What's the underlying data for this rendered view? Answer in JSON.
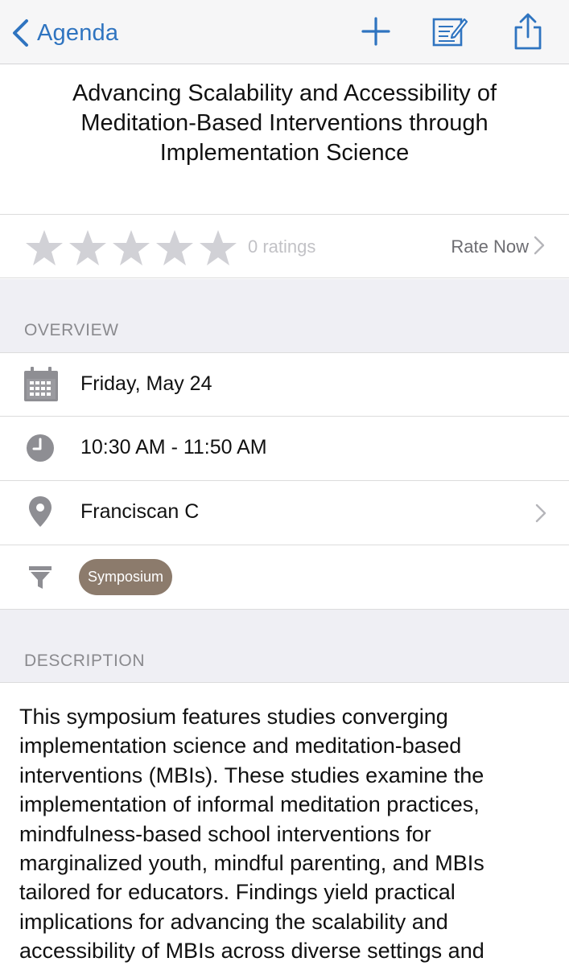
{
  "navbar": {
    "back_label": "Agenda",
    "icons": [
      "chevron-left-icon",
      "plus-icon",
      "notes-icon",
      "share-icon"
    ],
    "accent_color": "#2f74c0"
  },
  "session": {
    "title": "Advancing Scalability and Accessibility of Meditation-Based Interventions through Implementation Science"
  },
  "rating": {
    "stars_filled": 0,
    "stars_total": 5,
    "count_label": "0 ratings",
    "rate_now_label": "Rate Now"
  },
  "overview": {
    "header": "OVERVIEW",
    "date": "Friday, May 24",
    "time": "10:30 AM - 11:50 AM",
    "location": "Franciscan C",
    "tag": "Symposium",
    "tag_color": "#8c7b6c",
    "icons": [
      "calendar-icon",
      "clock-icon",
      "location-pin-icon",
      "filter-icon"
    ]
  },
  "description": {
    "header": "DESCRIPTION",
    "body": "This symposium features studies converging implementation science and meditation-based interventions (MBIs). These studies examine the implementation of informal meditation practices, mindfulness-based school interventions for marginalized youth, mindful parenting, and MBIs tailored for educators. Findings yield practical implications for advancing the scalability and accessibility of MBIs across diverse settings and"
  }
}
